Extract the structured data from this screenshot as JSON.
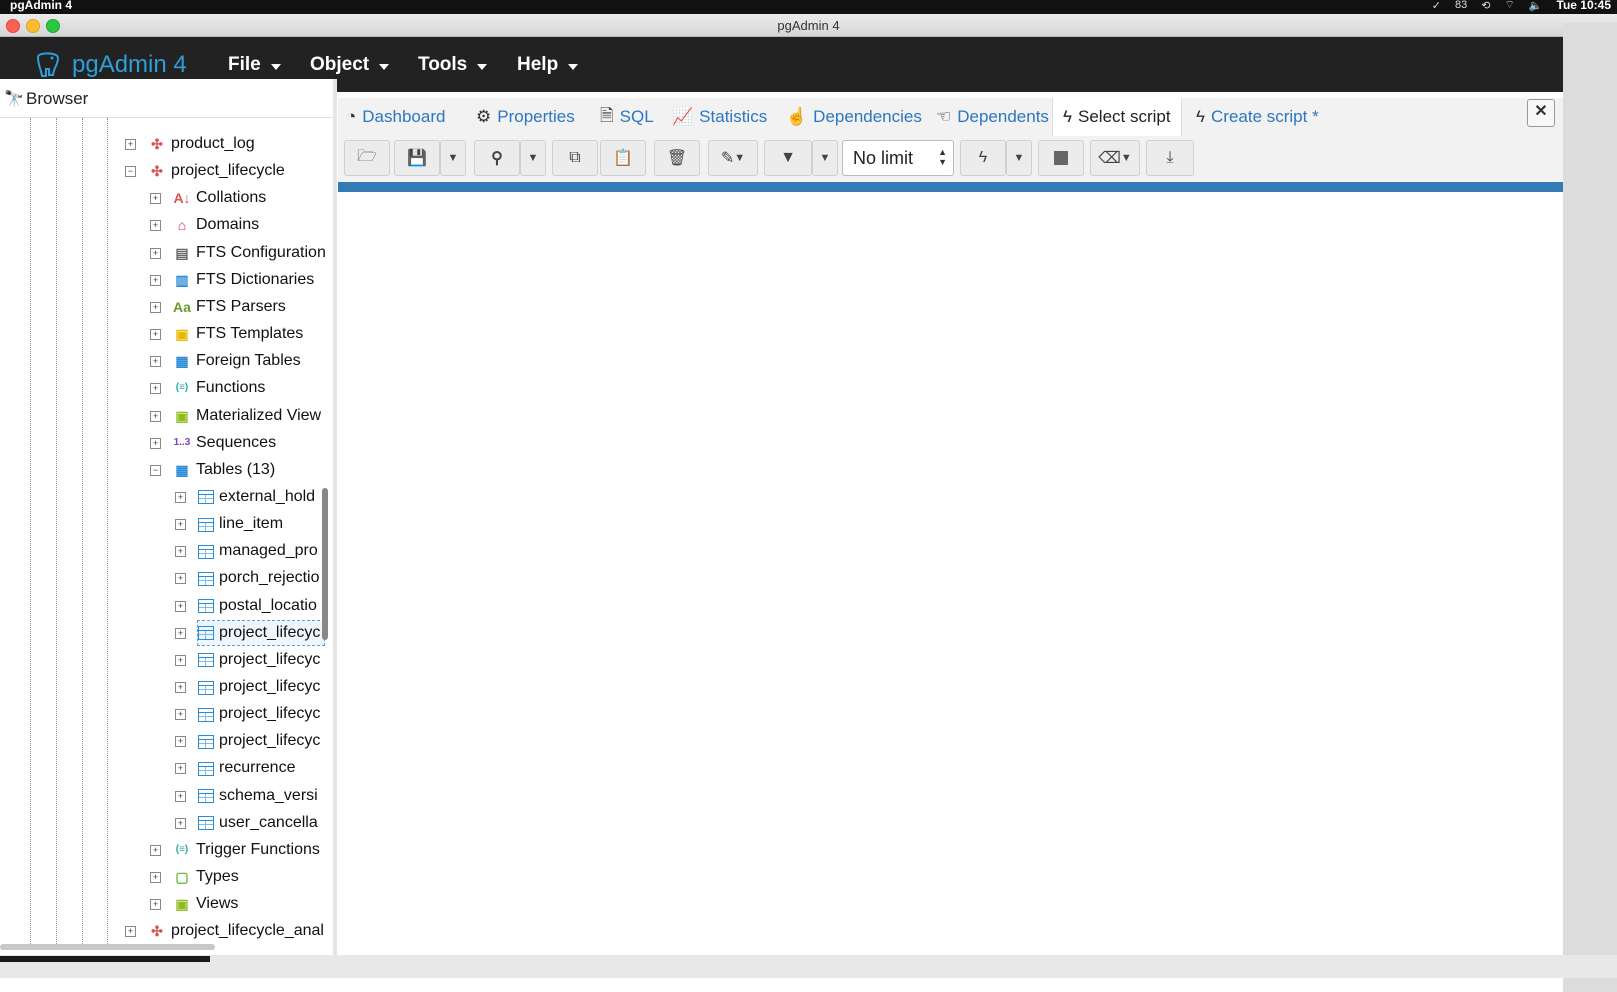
{
  "menubar": {
    "app_name": "pgAdmin 4",
    "clock": "Tue 10:45",
    "battery_label": "83"
  },
  "window": {
    "title": "pgAdmin 4"
  },
  "navbar": {
    "brand": "pgAdmin 4",
    "menus": [
      "File",
      "Object",
      "Tools",
      "Help"
    ]
  },
  "browser": {
    "title": "Browser",
    "tree": [
      {
        "label": "product_log",
        "icon": "schema-icon",
        "level": 0,
        "expanded": false
      },
      {
        "label": "project_lifecycle",
        "icon": "schema-icon",
        "level": 0,
        "expanded": true
      },
      {
        "label": "Collations",
        "icon": "collation-icon",
        "level": 1,
        "expanded": false
      },
      {
        "label": "Domains",
        "icon": "domain-icon",
        "level": 1,
        "expanded": false
      },
      {
        "label": "FTS Configuration",
        "icon": "fts-config-icon",
        "level": 1,
        "expanded": false
      },
      {
        "label": "FTS Dictionaries",
        "icon": "fts-dictionary-icon",
        "level": 1,
        "expanded": false
      },
      {
        "label": "FTS Parsers",
        "icon": "fts-parser-icon",
        "level": 1,
        "expanded": false
      },
      {
        "label": "FTS Templates",
        "icon": "fts-template-icon",
        "level": 1,
        "expanded": false
      },
      {
        "label": "Foreign Tables",
        "icon": "foreign-table-icon",
        "level": 1,
        "expanded": false
      },
      {
        "label": "Functions",
        "icon": "function-icon",
        "level": 1,
        "expanded": false
      },
      {
        "label": "Materialized View",
        "icon": "materialized-view-icon",
        "level": 1,
        "expanded": false
      },
      {
        "label": "Sequences",
        "icon": "sequence-icon",
        "level": 1,
        "expanded": false
      },
      {
        "label": "Tables (13)",
        "icon": "tables-icon",
        "level": 1,
        "expanded": true
      },
      {
        "label": "external_hold",
        "icon": "table-icon",
        "level": 2,
        "expanded": false
      },
      {
        "label": "line_item",
        "icon": "table-icon",
        "level": 2,
        "expanded": false
      },
      {
        "label": "managed_pro",
        "icon": "table-icon",
        "level": 2,
        "expanded": false
      },
      {
        "label": "porch_rejectio",
        "icon": "table-icon",
        "level": 2,
        "expanded": false
      },
      {
        "label": "postal_locatio",
        "icon": "table-icon",
        "level": 2,
        "expanded": false
      },
      {
        "label": "project_lifecyc",
        "icon": "table-icon",
        "level": 2,
        "expanded": false,
        "selected": true
      },
      {
        "label": "project_lifecyc",
        "icon": "table-icon",
        "level": 2,
        "expanded": false
      },
      {
        "label": "project_lifecyc",
        "icon": "table-icon",
        "level": 2,
        "expanded": false
      },
      {
        "label": "project_lifecyc",
        "icon": "table-icon",
        "level": 2,
        "expanded": false
      },
      {
        "label": "project_lifecyc",
        "icon": "table-icon",
        "level": 2,
        "expanded": false
      },
      {
        "label": "recurrence",
        "icon": "table-icon",
        "level": 2,
        "expanded": false
      },
      {
        "label": "schema_versi",
        "icon": "table-icon",
        "level": 2,
        "expanded": false
      },
      {
        "label": "user_cancella",
        "icon": "table-icon",
        "level": 2,
        "expanded": false
      },
      {
        "label": "Trigger Functions",
        "icon": "trigger-function-icon",
        "level": 1,
        "expanded": false
      },
      {
        "label": "Types",
        "icon": "type-icon",
        "level": 1,
        "expanded": false
      },
      {
        "label": "Views",
        "icon": "view-icon",
        "level": 1,
        "expanded": false
      },
      {
        "label": "project_lifecycle_anal",
        "icon": "schema-icon",
        "level": 0,
        "expanded": false
      }
    ]
  },
  "tabs": [
    {
      "label": "Dashboard",
      "icon": "dashboard-icon",
      "active": false
    },
    {
      "label": "Properties",
      "icon": "cogs-icon",
      "active": false
    },
    {
      "label": "SQL",
      "icon": "file-icon",
      "active": false
    },
    {
      "label": "Statistics",
      "icon": "line-chart-icon",
      "active": false
    },
    {
      "label": "Dependencies",
      "icon": "hand-pointer-icon",
      "active": false
    },
    {
      "label": "Dependents",
      "icon": "hand-left-icon",
      "active": false
    },
    {
      "label": "Select script",
      "icon": "bolt-icon",
      "active": true
    },
    {
      "label": "Create script *",
      "icon": "bolt-icon",
      "active": false
    }
  ],
  "toolbar": {
    "limit_value": "No limit",
    "buttons": [
      "open-file",
      "save",
      "save-dropdown",
      "find",
      "find-dropdown",
      "copy",
      "paste",
      "delete",
      "edit",
      "filter",
      "filter-dropdown",
      "execute",
      "execute-dropdown",
      "stop",
      "clear",
      "download"
    ]
  },
  "colors": {
    "navbar_bg": "#222222",
    "brand": "#2c9ed8",
    "tab_link": "#2c76c2",
    "progress": "#337ab7"
  }
}
